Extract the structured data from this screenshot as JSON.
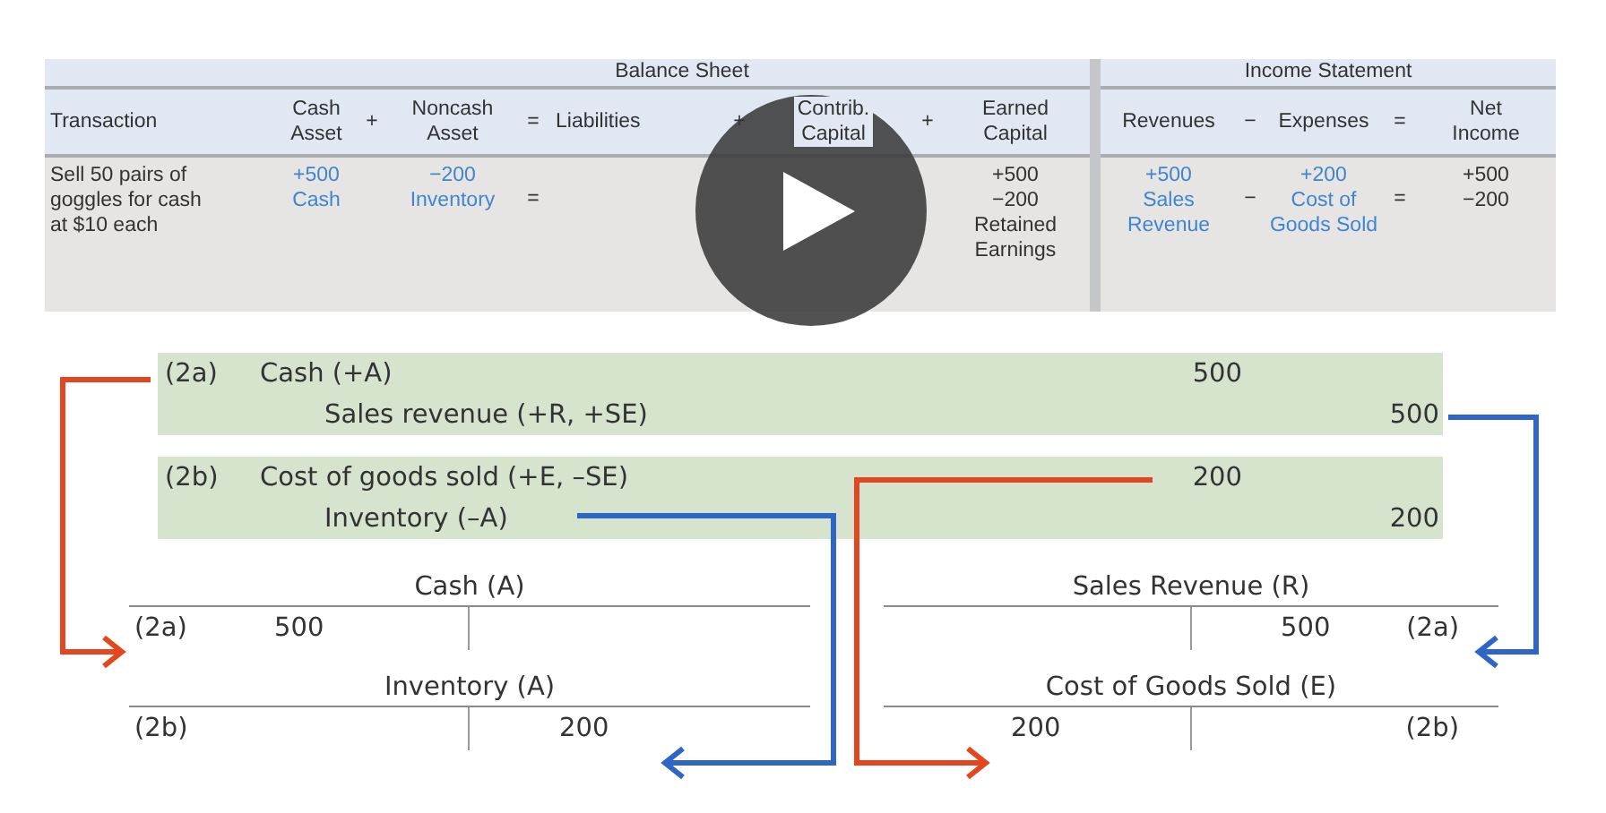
{
  "table": {
    "row_label_header": "Transaction",
    "sections": [
      {
        "title": "Balance Sheet",
        "columns": [
          {
            "kind": "account",
            "lines": [
              "Cash",
              "Asset"
            ]
          },
          {
            "kind": "operator",
            "lines": [
              "+"
            ]
          },
          {
            "kind": "account",
            "lines": [
              "Noncash",
              "Asset"
            ]
          },
          {
            "kind": "operator",
            "lines": [
              "="
            ]
          },
          {
            "kind": "account",
            "lines": [
              "Liabilities"
            ]
          },
          {
            "kind": "operator",
            "lines": [
              "+"
            ]
          },
          {
            "kind": "account",
            "lines": [
              "Contrib.",
              "Capital"
            ]
          },
          {
            "kind": "operator",
            "lines": [
              "+"
            ]
          },
          {
            "kind": "account",
            "lines": [
              "Earned",
              "Capital"
            ]
          }
        ]
      },
      {
        "title": "Income Statement",
        "columns": [
          {
            "kind": "account",
            "lines": [
              "Revenues"
            ]
          },
          {
            "kind": "operator",
            "lines": [
              "−"
            ]
          },
          {
            "kind": "account",
            "lines": [
              "Expenses"
            ]
          },
          {
            "kind": "operator",
            "lines": [
              "="
            ]
          },
          {
            "kind": "account",
            "lines": [
              "Net",
              "Income"
            ]
          }
        ]
      }
    ],
    "rows": [
      {
        "label_lines": [
          "Sell 50 pairs of",
          "goggles for cash",
          "at $10 each"
        ],
        "sections": [
          {
            "cells": [
              {
                "lines": [
                  "+500",
                  "Cash"
                ],
                "highlight": true
              },
              {},
              {
                "lines": [
                  "−200",
                  "Inventory"
                ],
                "highlight": true
              },
              {
                "lines": [
                  "="
                ],
                "highlight": false
              },
              {},
              {},
              {},
              {},
              {
                "lines": [
                  "+500",
                  "−200",
                  "Retained",
                  "Earnings"
                ],
                "highlight": false
              }
            ]
          },
          {
            "cells": [
              {
                "lines": [
                  "+500",
                  "Sales",
                  "Revenue"
                ],
                "highlight": true
              },
              {
                "lines": [
                  "−"
                ],
                "highlight": false
              },
              {
                "lines": [
                  "+200",
                  "Cost of",
                  "Goods Sold"
                ],
                "highlight": true
              },
              {
                "lines": [
                  "="
                ],
                "highlight": false
              },
              {
                "lines": [
                  "+500",
                  "−200"
                ],
                "highlight": false
              }
            ]
          }
        ]
      }
    ]
  },
  "journal": [
    {
      "ref": "(2a)",
      "lines": [
        {
          "kind": "debit",
          "account": "Cash (+A)",
          "amount": "500"
        },
        {
          "kind": "credit",
          "account": "Sales revenue (+R, +SE)",
          "amount": "500"
        }
      ]
    },
    {
      "ref": "(2b)",
      "lines": [
        {
          "kind": "debit",
          "account": "Cost of goods sold (+E, –SE)",
          "amount": "200"
        },
        {
          "kind": "credit",
          "account": "Inventory (–A)",
          "amount": "200"
        }
      ]
    }
  ],
  "t_accounts": [
    [
      {
        "title": "Cash (A)",
        "debit_ref": "(2a)",
        "debit": "500"
      },
      {
        "title": "Sales Revenue (R)",
        "credit": "500",
        "credit_ref": "(2a)"
      }
    ],
    [
      {
        "title": "Inventory (A)",
        "debit_ref": "(2b)",
        "credit": "200"
      },
      {
        "title": "Cost of Goods Sold (E)",
        "debit": "200",
        "credit_ref": "(2b)"
      }
    ]
  ],
  "video": {
    "paused": true
  }
}
